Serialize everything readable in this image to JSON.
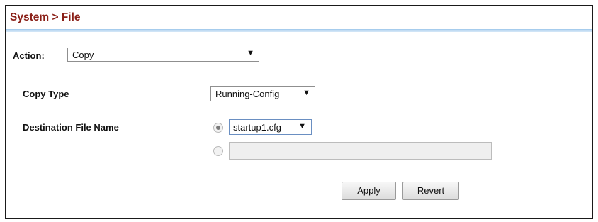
{
  "header": {
    "title": "System > File"
  },
  "action": {
    "label": "Action:",
    "selected": "Copy"
  },
  "form": {
    "copy_type": {
      "label": "Copy Type",
      "selected": "Running-Config"
    },
    "destination": {
      "label": "Destination File Name",
      "selected_file": "startup1.cfg",
      "custom_name_value": "",
      "radio_selected": "existing-file"
    }
  },
  "buttons": {
    "apply": "Apply",
    "revert": "Revert"
  },
  "icons": {
    "dropdown_arrow": "dropdown-arrow-icon"
  },
  "colors": {
    "title": "#8a1f17",
    "title_rule": "#9fc8ec",
    "focus_border": "#6a8fc2"
  }
}
